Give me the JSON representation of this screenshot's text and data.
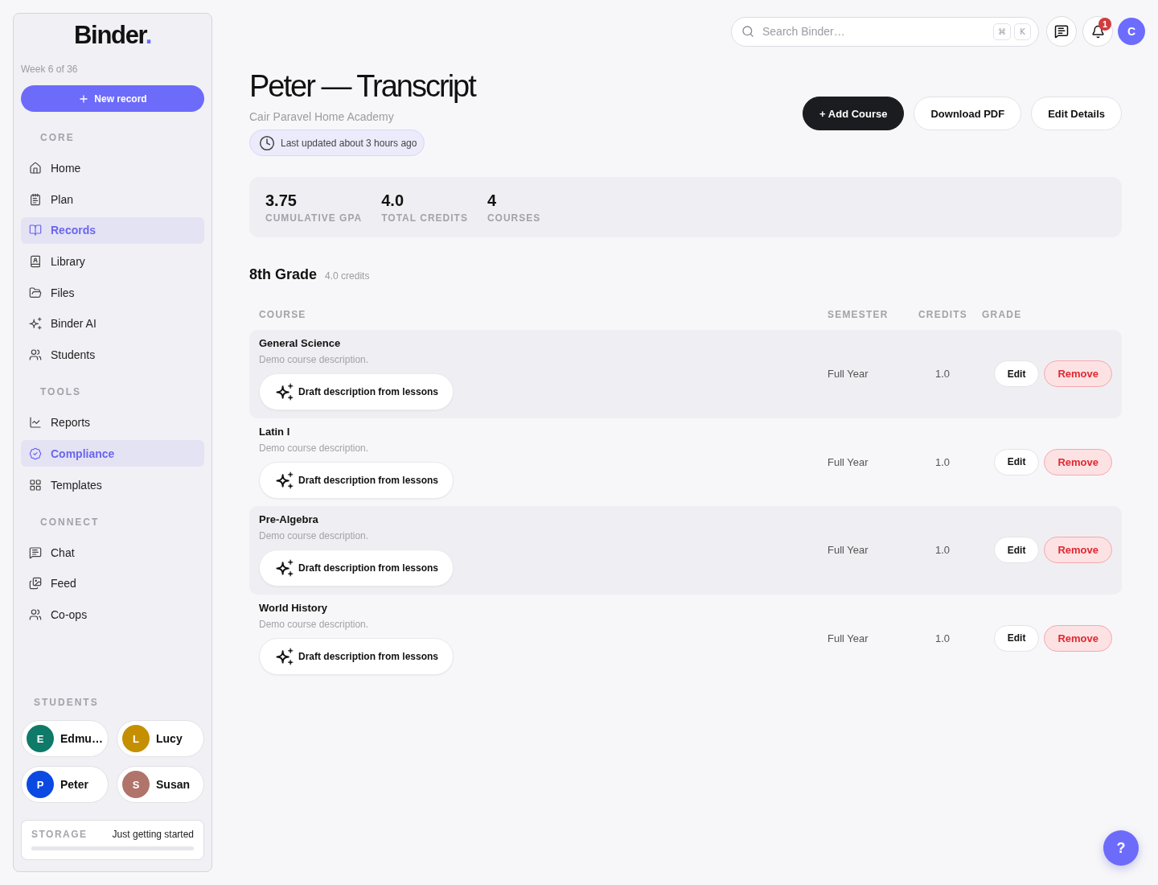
{
  "sidebar": {
    "logo": {
      "text": "Binder",
      "dot": "."
    },
    "week": "Week 6 of 36",
    "new_button": {
      "label": "New record"
    },
    "sections": [
      {
        "title": "CORE",
        "items": [
          {
            "label": "Home",
            "selected": false
          },
          {
            "label": "Plan",
            "selected": false
          },
          {
            "label": "Records",
            "selected": true
          },
          {
            "label": "Library",
            "selected": false
          },
          {
            "label": "Files",
            "selected": false
          },
          {
            "label": "Binder AI",
            "selected": false
          },
          {
            "label": "Students",
            "selected": false
          }
        ]
      },
      {
        "title": "TOOLS",
        "items": [
          {
            "label": "Reports",
            "selected": false
          },
          {
            "label": "Compliance",
            "selected": true
          },
          {
            "label": "Templates",
            "selected": false
          }
        ]
      },
      {
        "title": "CONNECT",
        "items": [
          {
            "label": "Chat",
            "selected": false
          },
          {
            "label": "Feed",
            "selected": false
          },
          {
            "label": "Co-ops",
            "selected": false
          }
        ]
      }
    ],
    "students": {
      "title": "STUDENTS",
      "items": [
        {
          "initial": "E",
          "name": "Edmu…",
          "color": "#0f7a68"
        },
        {
          "initial": "L",
          "name": "Lucy",
          "color": "#c48f00"
        },
        {
          "initial": "P",
          "name": "Peter",
          "color": "#0b49e3"
        },
        {
          "initial": "S",
          "name": "Susan",
          "color": "#b0746a"
        }
      ]
    },
    "storage": {
      "label": "STORAGE",
      "status": "Just getting started"
    }
  },
  "top_bar": {
    "search": {
      "placeholder": "Search Binder…",
      "keys": [
        "⌘",
        "K"
      ]
    },
    "notifications": {
      "count": "1"
    },
    "avatar": {
      "initial": "C"
    }
  },
  "header": {
    "title": "Peter — Transcript",
    "subtitle": "Cair Paravel Home Academy",
    "updated": "Last updated about 3 hours ago",
    "buttons": [
      {
        "label": "+ Add Course",
        "kind": "primary"
      },
      {
        "label": "Download PDF",
        "kind": "secondary"
      },
      {
        "label": "Edit Details",
        "kind": "secondary"
      }
    ]
  },
  "stats": [
    {
      "value": "3.75",
      "label": "CUMULATIVE GPA"
    },
    {
      "value": "4.0",
      "label": "TOTAL CREDITS"
    },
    {
      "value": "4",
      "label": "COURSES"
    }
  ],
  "grade_section": {
    "title": "8th Grade",
    "credits": "4.0 credits",
    "columns": [
      "COURSE",
      "SEMESTER",
      "CREDITS",
      "GRADE"
    ],
    "rows": [
      {
        "course": "General Science",
        "description": "Demo course description.",
        "draft_button": "Draft description from lessons",
        "semester": "Full Year",
        "credits": "1.0",
        "edit": "Edit",
        "remove": "Remove"
      },
      {
        "course": "Latin I",
        "description": "Demo course description.",
        "draft_button": "Draft description from lessons",
        "semester": "Full Year",
        "credits": "1.0",
        "edit": "Edit",
        "remove": "Remove"
      },
      {
        "course": "Pre-Algebra",
        "description": "Demo course description.",
        "draft_button": "Draft description from lessons",
        "semester": "Full Year",
        "credits": "1.0",
        "edit": "Edit",
        "remove": "Remove"
      },
      {
        "course": "World History",
        "description": "Demo course description.",
        "draft_button": "Draft description from lessons",
        "semester": "Full Year",
        "credits": "1.0",
        "edit": "Edit",
        "remove": "Remove"
      }
    ]
  },
  "help_button": {
    "label": "?"
  }
}
